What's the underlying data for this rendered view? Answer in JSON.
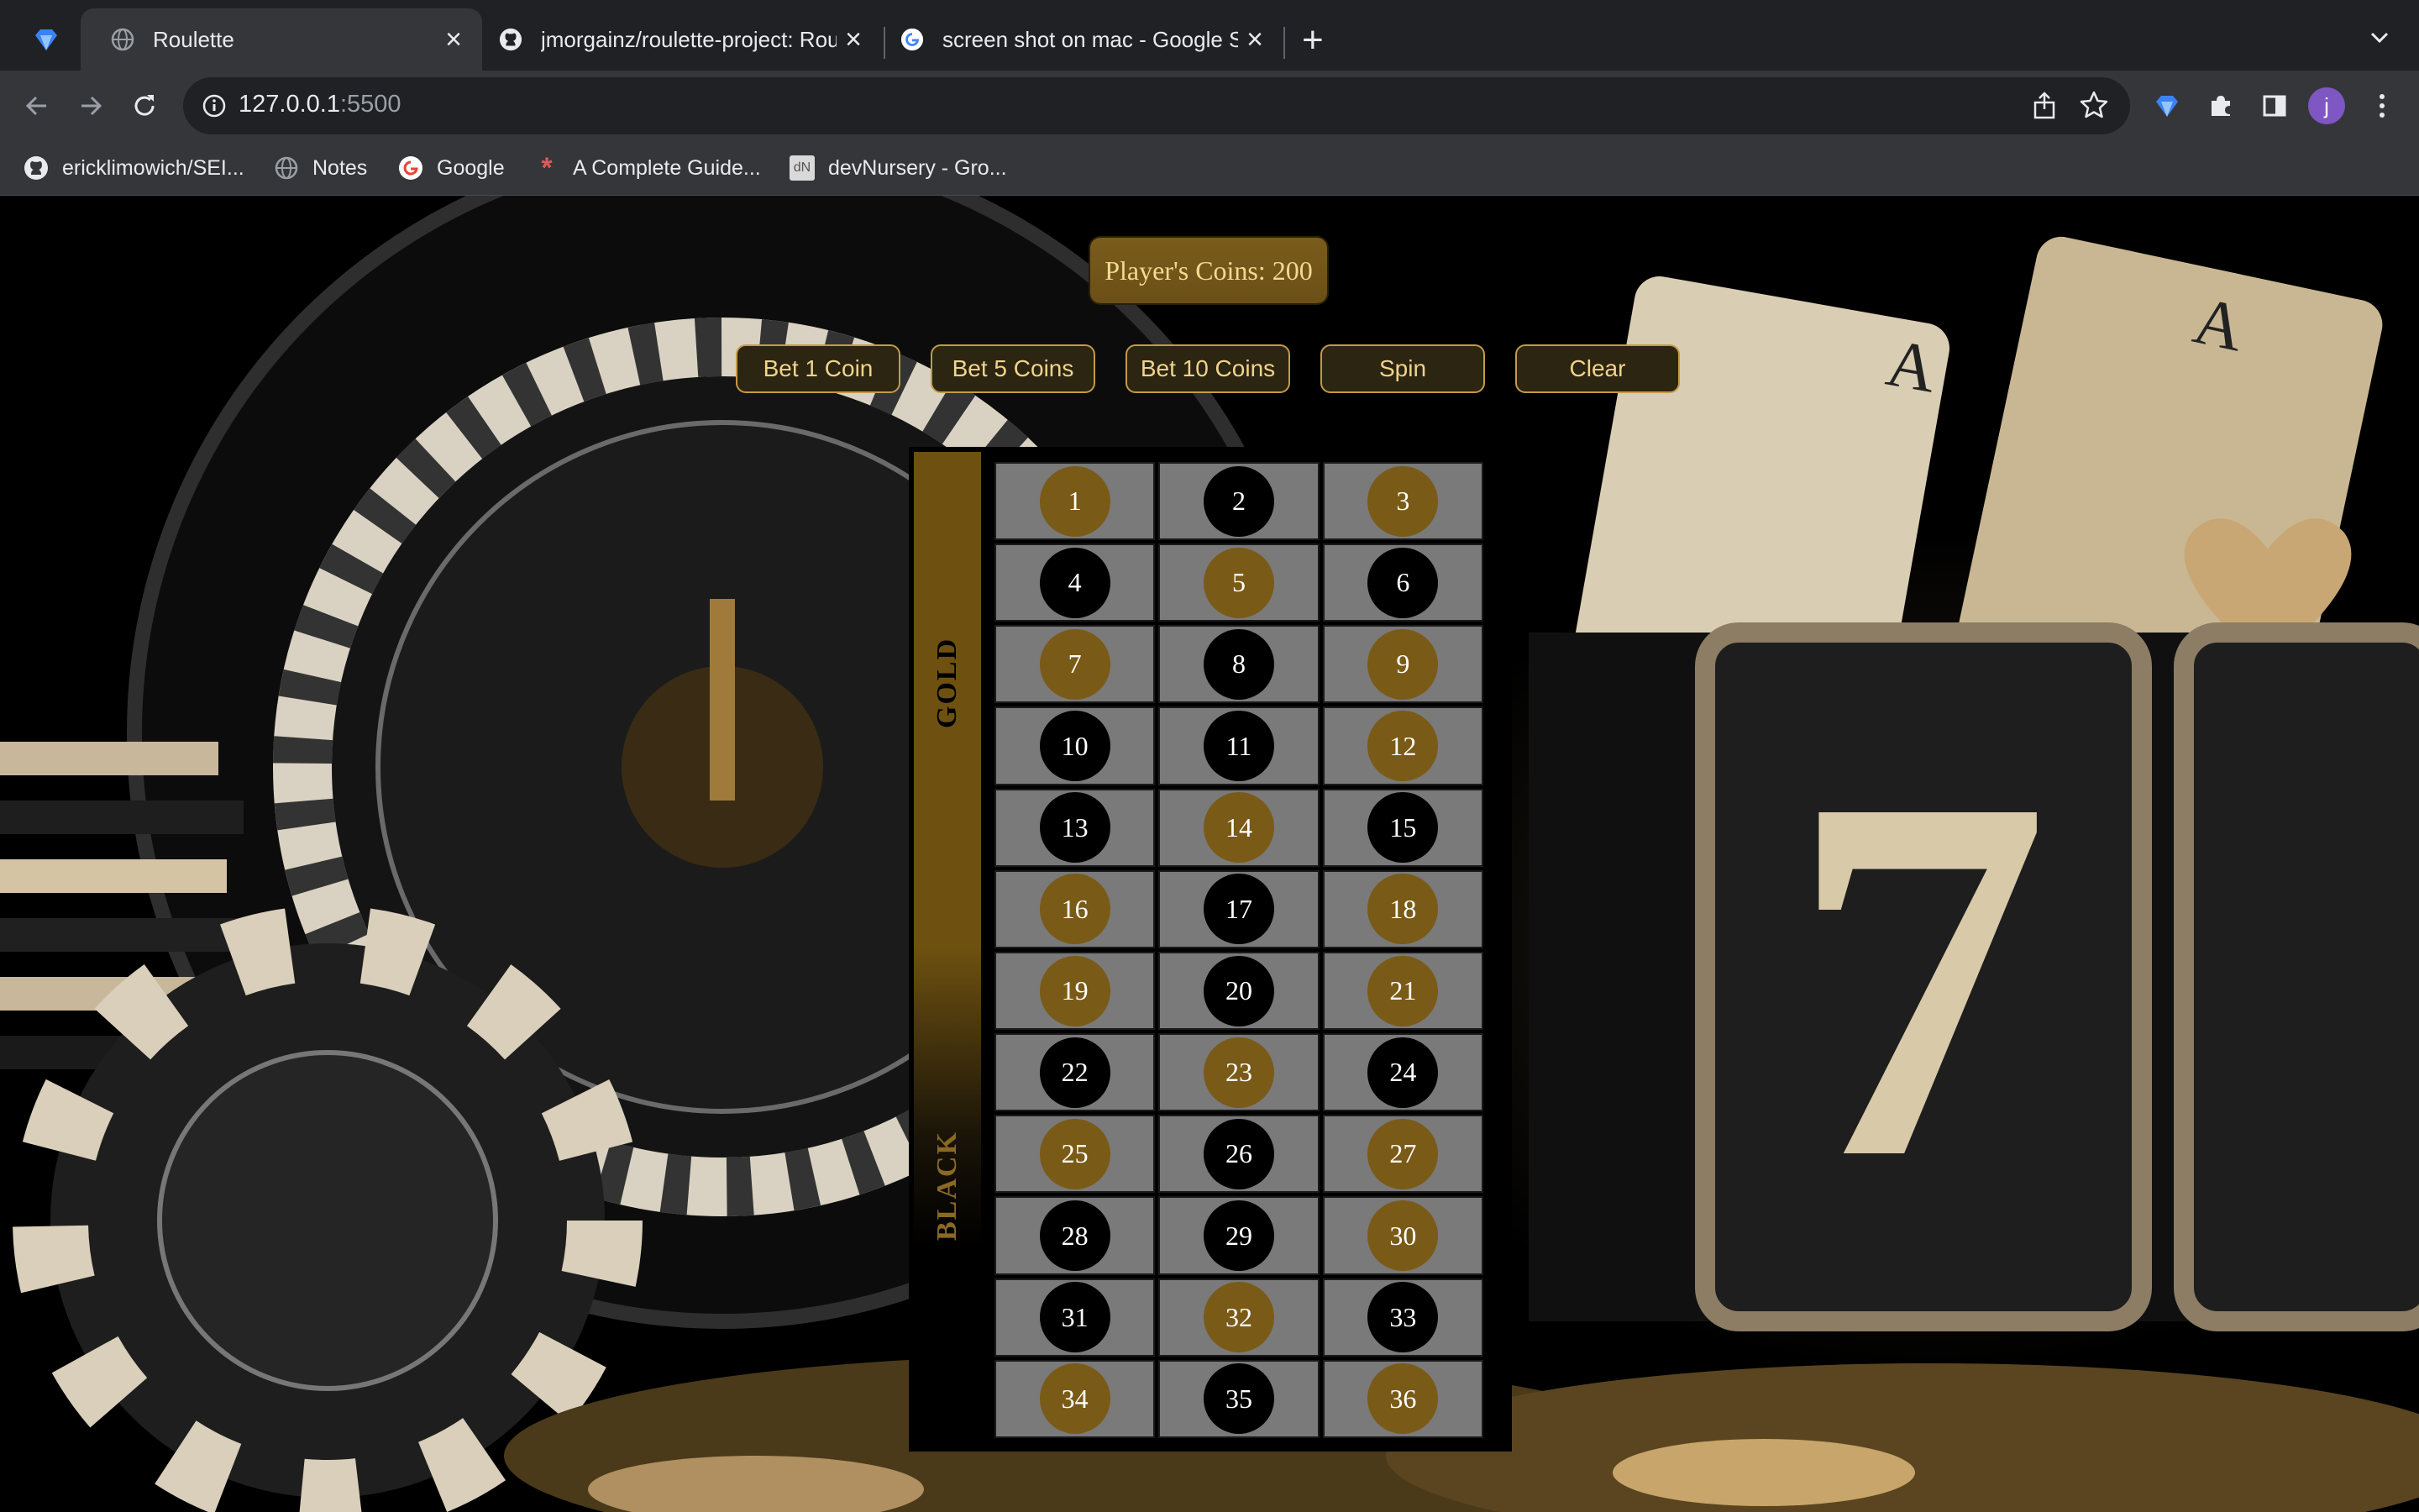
{
  "browser": {
    "tabs": [
      {
        "title": "Roulette",
        "active": true,
        "icon": "globe-icon"
      },
      {
        "title": "jmorgainz/roulette-project: Rou",
        "active": false,
        "icon": "github-icon"
      },
      {
        "title": "screen shot on mac - Google S",
        "active": false,
        "icon": "google-icon"
      }
    ],
    "url_host": "127.0.0.1",
    "url_port": ":5500",
    "avatar_letter": "j",
    "bookmarks": [
      {
        "label": "ericklimowich/SEI...",
        "icon": "github-icon"
      },
      {
        "label": "Notes",
        "icon": "globe-icon"
      },
      {
        "label": "Google",
        "icon": "google-icon"
      },
      {
        "label": "A Complete Guide...",
        "icon": "asterisk-icon"
      },
      {
        "label": "devNursery - Gro...",
        "icon": "dn-icon"
      }
    ]
  },
  "game": {
    "coins_label": "Player's Coins: 200",
    "buttons": {
      "bet1": "Bet 1 Coin",
      "bet5": "Bet 5 Coins",
      "bet10": "Bet 10 Coins",
      "spin": "Spin",
      "clear": "Clear"
    },
    "side_labels": {
      "gold": "GOLD",
      "black": "BLACK"
    },
    "colors": {
      "gold": "#7a5a17",
      "black": "#000000",
      "cell": "#7a7a7a",
      "button_text": "#f2d38c"
    },
    "numbers": [
      {
        "n": "1",
        "c": "gold"
      },
      {
        "n": "2",
        "c": "black"
      },
      {
        "n": "3",
        "c": "gold"
      },
      {
        "n": "4",
        "c": "black"
      },
      {
        "n": "5",
        "c": "gold"
      },
      {
        "n": "6",
        "c": "black"
      },
      {
        "n": "7",
        "c": "gold"
      },
      {
        "n": "8",
        "c": "black"
      },
      {
        "n": "9",
        "c": "gold"
      },
      {
        "n": "10",
        "c": "black"
      },
      {
        "n": "11",
        "c": "black"
      },
      {
        "n": "12",
        "c": "gold"
      },
      {
        "n": "13",
        "c": "black"
      },
      {
        "n": "14",
        "c": "gold"
      },
      {
        "n": "15",
        "c": "black"
      },
      {
        "n": "16",
        "c": "gold"
      },
      {
        "n": "17",
        "c": "black"
      },
      {
        "n": "18",
        "c": "gold"
      },
      {
        "n": "19",
        "c": "gold"
      },
      {
        "n": "20",
        "c": "black"
      },
      {
        "n": "21",
        "c": "gold"
      },
      {
        "n": "22",
        "c": "black"
      },
      {
        "n": "23",
        "c": "gold"
      },
      {
        "n": "24",
        "c": "black"
      },
      {
        "n": "25",
        "c": "gold"
      },
      {
        "n": "26",
        "c": "black"
      },
      {
        "n": "27",
        "c": "gold"
      },
      {
        "n": "28",
        "c": "black"
      },
      {
        "n": "29",
        "c": "black"
      },
      {
        "n": "30",
        "c": "gold"
      },
      {
        "n": "31",
        "c": "black"
      },
      {
        "n": "32",
        "c": "gold"
      },
      {
        "n": "33",
        "c": "black"
      },
      {
        "n": "34",
        "c": "gold"
      },
      {
        "n": "35",
        "c": "black"
      },
      {
        "n": "36",
        "c": "gold"
      }
    ]
  }
}
